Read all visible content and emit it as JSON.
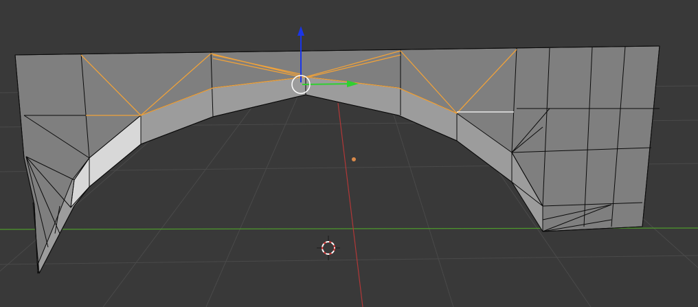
{
  "app": "3d-viewport",
  "viewport": {
    "background_color": "#393939",
    "grid_color": "#4a4a4a",
    "x_axis_color": "#b23838",
    "y_axis_color": "#4e9a2c"
  },
  "mesh": {
    "face_color": "#7f7f7f",
    "face_light_color": "#9c9c9c",
    "face_highlight_color": "#d8d8d8",
    "wire_color": "#0a0a0a",
    "selected_edge_color": "#f0a23a",
    "active_edge_color": "#ffffff"
  },
  "gizmo": {
    "z_arrow_color": "#1a35e8",
    "y_arrow_color": "#2fd02f",
    "pivot_ring_color": "#ffffff"
  },
  "origin_point_color": "#d98a4a",
  "cursor_3d_colors": [
    "#d63a3a",
    "#ffffff"
  ]
}
